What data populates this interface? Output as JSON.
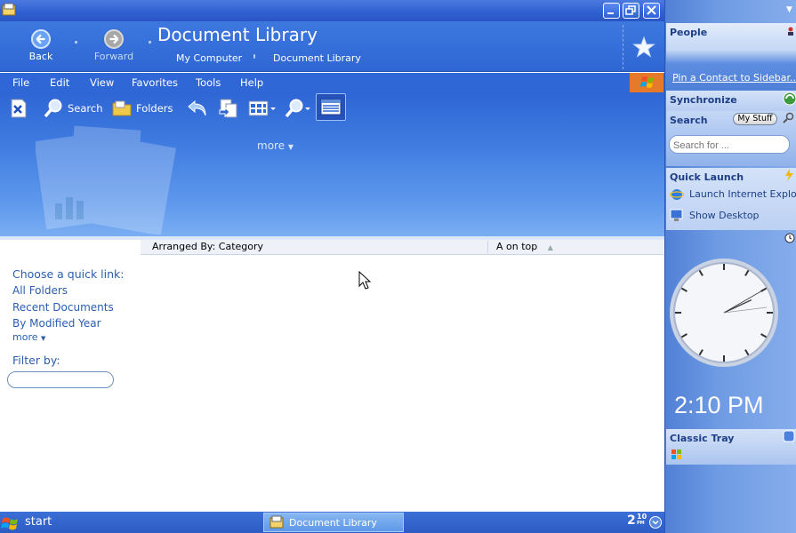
{
  "window": {
    "title": "Document Library",
    "nav": {
      "back": "Back",
      "forward": "Forward"
    },
    "breadcrumbs": [
      "My Computer",
      "Document Library"
    ]
  },
  "menu": [
    "File",
    "Edit",
    "View",
    "Favorites",
    "Tools",
    "Help"
  ],
  "toolbar": {
    "search": "Search",
    "folders": "Folders",
    "more": "more"
  },
  "list": {
    "arranged_by": "Arranged By: Category",
    "sort": "A on top"
  },
  "left_panel": {
    "quick_link_heading": "Choose a quick link:",
    "links": [
      "All Folders",
      "Recent Documents",
      "By Modified Year"
    ],
    "more": "more",
    "filter_heading": "Filter by:"
  },
  "desk_sidebar": {
    "people": "People",
    "pin_contact": "Pin a Contact to Sidebar...",
    "synchronize": "Synchronize",
    "search": "Search",
    "my_stuff": "My Stuff",
    "search_placeholder": "Search for ...",
    "quick_launch": "Quick Launch",
    "launch_ie": "Launch Internet Explorer",
    "show_desktop": "Show Desktop",
    "clock_time": "2:10 PM",
    "classic_tray": "Classic Tray"
  },
  "taskbar": {
    "start": "start",
    "task": "Document Library",
    "tray_hour": "2",
    "tray_min": "10",
    "tray_ampm": "PM"
  },
  "clock": {
    "hour": 2,
    "minute": 10
  },
  "colors": {
    "accent": "#2f67d6",
    "link": "#2a5db0",
    "flag": "#e57a2a"
  }
}
